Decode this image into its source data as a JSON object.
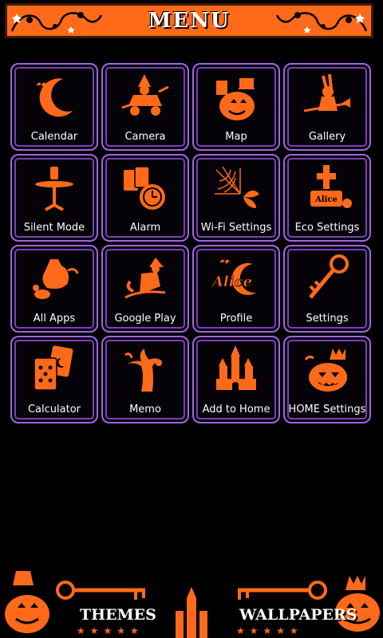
{
  "header": {
    "title": "MENU"
  },
  "tiles": [
    {
      "label": "Calendar",
      "icon": "moon-bats-icon"
    },
    {
      "label": "Camera",
      "icon": "witch-carriage-icon"
    },
    {
      "label": "Map",
      "icon": "pumpkin-teacup-icon"
    },
    {
      "label": "Gallery",
      "icon": "rabbit-broom-icon"
    },
    {
      "label": "Silent Mode",
      "icon": "table-bottle-icon"
    },
    {
      "label": "Alarm",
      "icon": "pocket-watch-cards-icon"
    },
    {
      "label": "Wi-Fi Settings",
      "icon": "spiderweb-butterfly-icon"
    },
    {
      "label": "Eco Settings",
      "icon": "gravestone-icon"
    },
    {
      "label": "All Apps",
      "icon": "teapot-mouse-icon"
    },
    {
      "label": "Google Play",
      "icon": "witch-moon-icon"
    },
    {
      "label": "Profile",
      "icon": "alice-logo-icon"
    },
    {
      "label": "Settings",
      "icon": "skeleton-key-icon"
    },
    {
      "label": "Calculator",
      "icon": "playing-cards-icon"
    },
    {
      "label": "Memo",
      "icon": "spooky-tree-icon"
    },
    {
      "label": "Add to Home",
      "icon": "castle-icon"
    },
    {
      "label": "HOME Settings",
      "icon": "crowned-pumpkin-icon"
    }
  ],
  "footer": {
    "themes_label": "THEMES",
    "wallpapers_label": "WALLPAPERS",
    "stars": "★★★★★"
  },
  "colors": {
    "accent": "#ff6a1a",
    "tile_border": "#a066e0",
    "background": "#000000"
  }
}
